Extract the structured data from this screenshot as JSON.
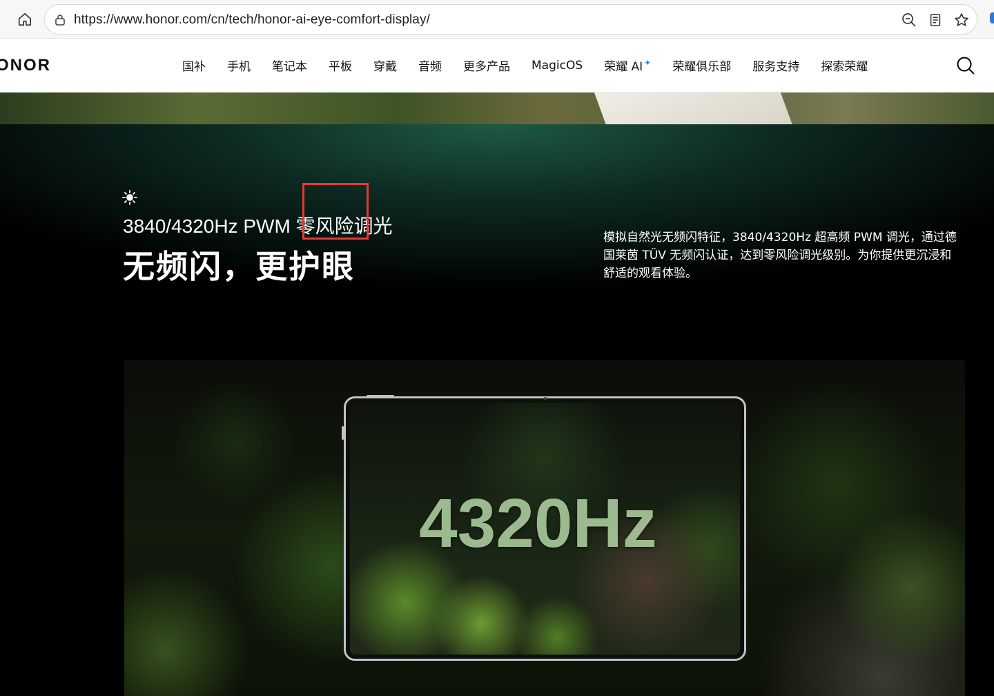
{
  "browser": {
    "url": "https://www.honor.com/cn/tech/honor-ai-eye-comfort-display/",
    "icons": [
      "home-icon",
      "site-info-icon",
      "zoom-icon",
      "reader-icon",
      "favorite-icon"
    ]
  },
  "header": {
    "logo": "ONOR",
    "nav": [
      "国补",
      "手机",
      "笔记本",
      "平板",
      "穿戴",
      "音频",
      "更多产品",
      "MagicOS",
      "荣耀 AI",
      "荣耀俱乐部",
      "服务支持",
      "探索荣耀"
    ],
    "ai_spark": "✦",
    "search_icon": "search-icon"
  },
  "section": {
    "sun_icon": "sun-icon",
    "subhead": "3840/4320Hz PWM 零风险调光",
    "headline": "无频闪，更护眼",
    "description": "模拟自然光无频闪特征，3840/4320Hz 超高频 PWM 调光，通过德国莱茵 TÜV 无频闪认证，达到零风险调光级别。为你提供更沉浸和舒适的观看体验。",
    "tablet_screen_text": "4320Hz",
    "highlight_color": "#e53935"
  }
}
